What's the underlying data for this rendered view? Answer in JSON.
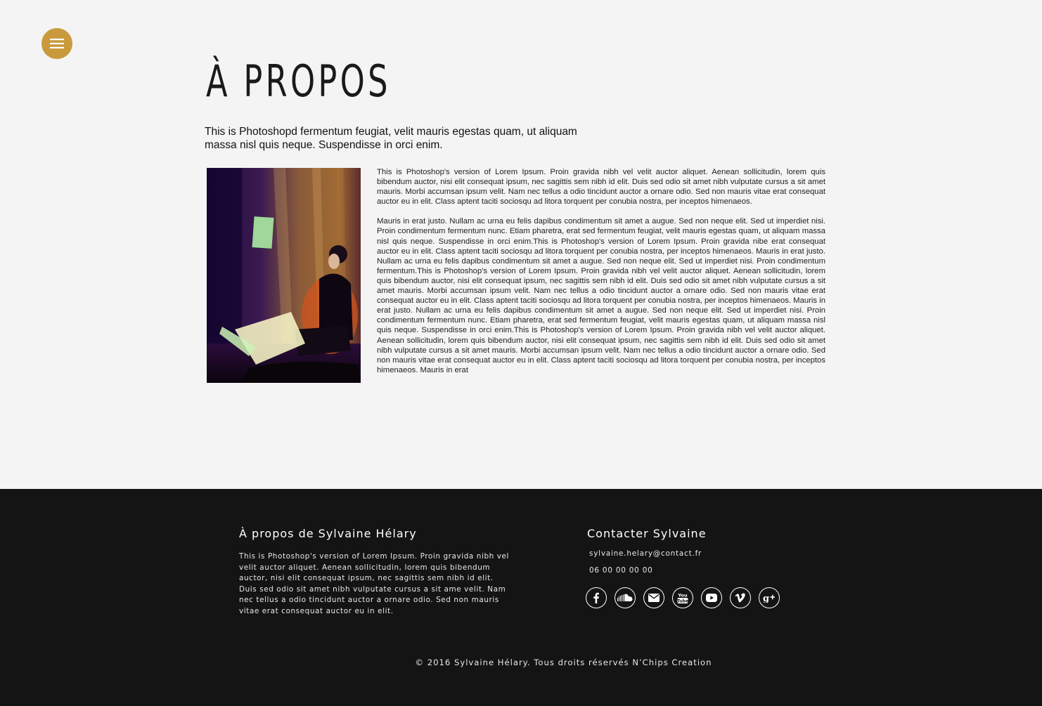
{
  "menu": {
    "icon": "hamburger-menu-icon",
    "accent_color": "#c99a3c"
  },
  "page": {
    "title": "À PROPOS",
    "intro": "This is Photoshopd fermentum feugiat, velit mauris egestas quam, ut aliquam massa nisl quis neque. Suspendisse in orci enim.",
    "paragraphs": [
      "This is Photoshop's version  of Lorem Ipsum. Proin gravida nibh vel velit auctor aliquet. Aenean sollicitudin, lorem quis bibendum auctor, nisi elit consequat ipsum, nec sagittis sem nibh id elit. Duis sed odio sit amet nibh vulputate cursus a sit amet mauris. Morbi accumsan ipsum velit. Nam nec tellus a odio tincidunt auctor a ornare odio. Sed non  mauris vitae erat consequat auctor eu in elit. Class aptent taciti sociosqu ad litora torquent per conubia nostra, per inceptos himenaeos.",
      "Mauris in erat justo. Nullam ac urna eu felis dapibus condimentum sit amet a augue. Sed non neque elit. Sed ut imperdiet nisi. Proin condimentum fermentum nunc. Etiam pharetra, erat sed fermentum feugiat, velit mauris egestas quam, ut aliquam massa nisl quis neque. Suspendisse in orci enim.This is Photoshop's version  of Lorem Ipsum. Proin gravida nibe erat consequat auctor eu in elit. Class aptent taciti sociosqu ad litora torquent per conubia nostra, per inceptos himenaeos. Mauris in erat justo. Nullam ac urna eu felis dapibus condimentum sit amet a augue. Sed non neque elit. Sed ut imperdiet nisi. Proin condimentum fermentum.This is Photoshop's version  of Lorem Ipsum. Proin gravida nibh vel velit auctor aliquet. Aenean sollicitudin, lorem quis bibendum auctor, nisi elit consequat ipsum, nec sagittis sem nibh id elit. Duis sed odio sit amet nibh vulputate cursus a sit amet mauris. Morbi accumsan ipsum velit. Nam nec tellus a odio tincidunt auctor a ornare odio. Sed non  mauris vitae erat consequat auctor eu in elit. Class aptent taciti sociosqu ad litora torquent per conubia nostra, per inceptos himenaeos. Mauris in erat justo. Nullam ac urna eu felis dapibus condimentum sit amet a augue. Sed non neque elit. Sed ut imperdiet nisi. Proin condimentum fermentum nunc. Etiam pharetra, erat sed fermentum feugiat, velit mauris egestas quam, ut aliquam massa nisl quis neque. Suspendisse in orci enim.This is Photoshop's version  of Lorem Ipsum. Proin gravida nibh vel velit auctor aliquet. Aenean sollicitudin, lorem quis bibendum auctor, nisi elit consequat ipsum, nec sagittis sem nibh id elit. Duis sed odio sit amet nibh vulputate cursus a sit amet mauris. Morbi accumsan ipsum velit. Nam nec tellus a odio tincidunt auctor a ornare odio. Sed non  mauris vitae erat consequat auctor eu in elit. Class aptent taciti sociosqu ad litora torquent per conubia nostra, per inceptos himenaeos. Mauris in erat"
    ]
  },
  "footer": {
    "about_heading": "À propos de Sylvaine Hélary",
    "about_text": "This is Photoshop's version  of Lorem Ipsum. Proin gravida nibh vel velit auctor aliquet. Aenean sollicitudin, lorem quis bibendum auctor, nisi elit consequat ipsum, nec sagittis sem nibh id elit. Duis sed odio sit amet nibh vulputate cursus a sit ame velit. Nam nec tellus a odio tincidunt auctor a ornare odio. Sed non mauris vitae erat consequat auctor eu in elit.",
    "contact_heading": "Contacter Sylvaine",
    "email": "sylvaine.helary@contact.fr",
    "phone": "06 00 00 00 00",
    "socials": [
      "facebook-icon",
      "soundcloud-icon",
      "email-icon",
      "youtube-text-icon",
      "youtube-play-icon",
      "vimeo-icon",
      "google-plus-icon"
    ],
    "copyright": "© 2016 Sylvaine Hélary. Tous droits réservés N’Chips Creation",
    "background_color": "#141414"
  }
}
